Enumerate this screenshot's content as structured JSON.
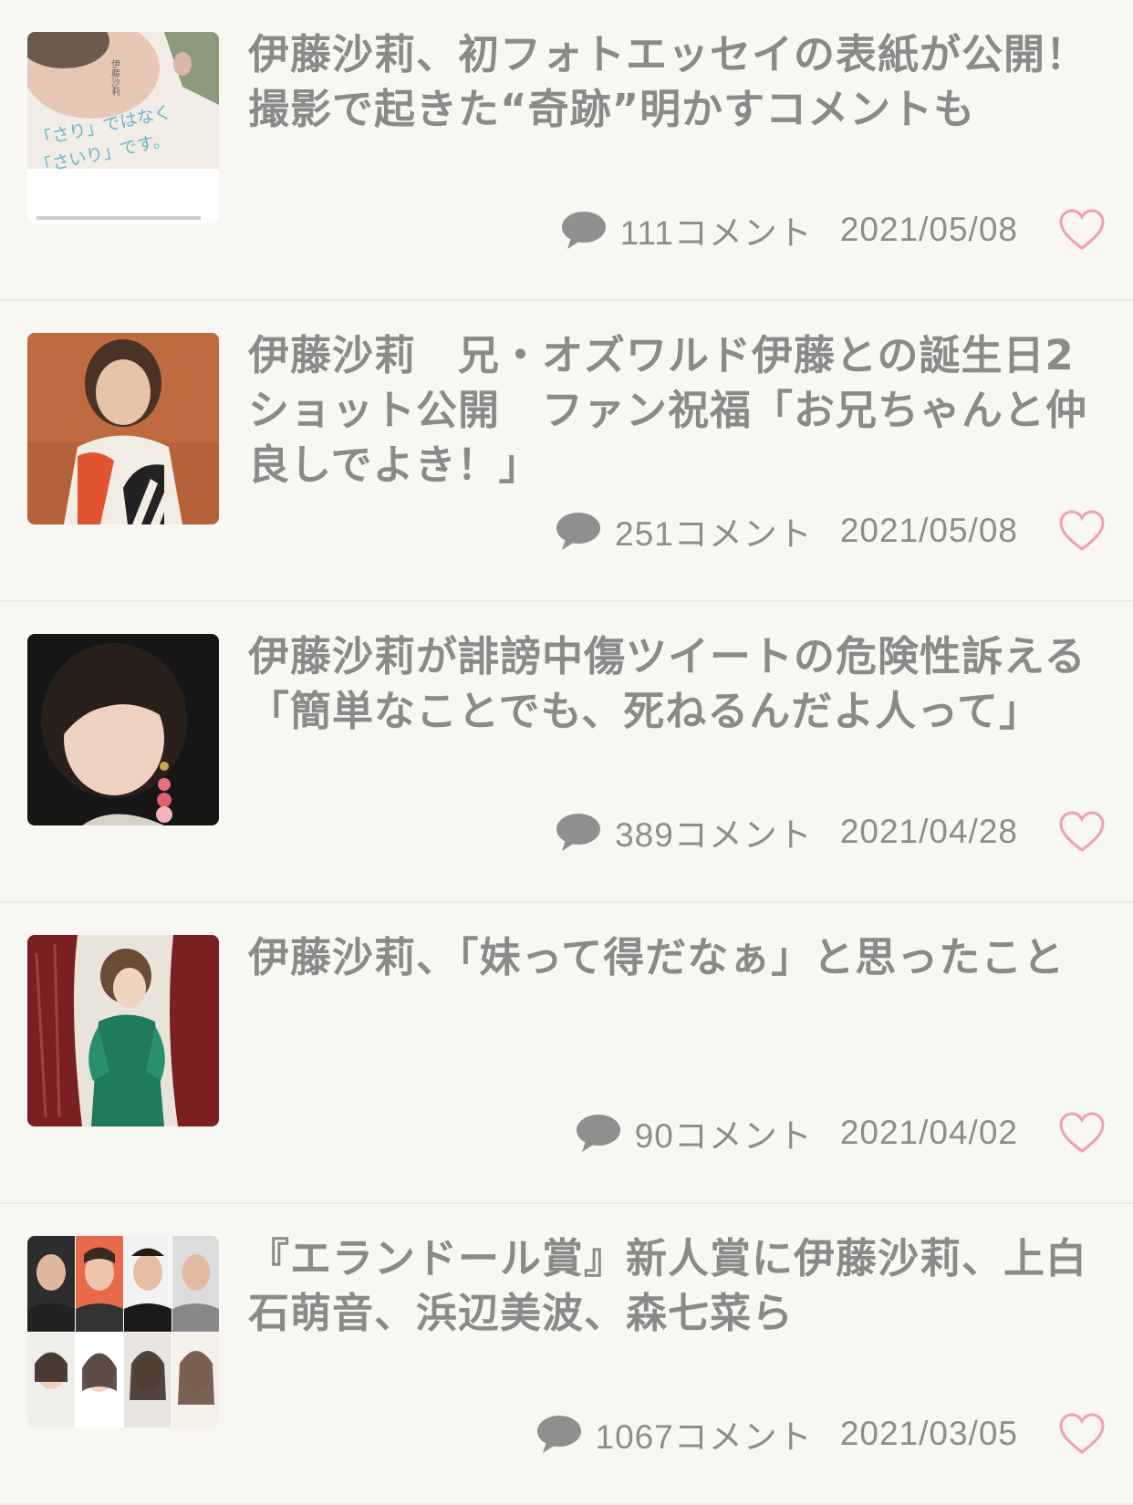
{
  "articles": [
    {
      "title": "伊藤沙莉、初フォトエッセイの表紙が公開！撮影で起きた“奇跡”明かすコメントも",
      "comments": "111コメント",
      "date": "2021/05/08",
      "thumb_icon": "book-cover-image",
      "thumb_text_1": "「さり」ではなく",
      "thumb_text_2": "「さいり」です。",
      "thumb_text_3": "伊藤沙莉"
    },
    {
      "title": "伊藤沙莉　兄・オズワルド伊藤との誕生日2ショット公開　ファン祝福「お兄ちゃんと仲良しでよき！」",
      "comments": "251コメント",
      "date": "2021/05/08",
      "thumb_icon": "portrait-photo"
    },
    {
      "title": "伊藤沙莉が誹謗中傷ツイートの危険性訴える「簡単なことでも、死ねるんだよ人って」",
      "comments": "389コメント",
      "date": "2021/04/28",
      "thumb_icon": "portrait-photo"
    },
    {
      "title": "伊藤沙莉、「妹って得だなぁ」と思ったこと",
      "comments": "90コメント",
      "date": "2021/04/02",
      "thumb_icon": "portrait-photo"
    },
    {
      "title": "『エランドール賞』新人賞に伊藤沙莉、上白石萌音、浜辺美波、森七菜ら",
      "comments": "1067コメント",
      "date": "2021/03/05",
      "thumb_icon": "collage-photo"
    }
  ],
  "colors": {
    "background": "#f8f7f1",
    "text": "#8a8a8a",
    "heart": "#f0a0ae",
    "comment_icon": "#8f8f8f",
    "divider": "#ecebe4"
  }
}
